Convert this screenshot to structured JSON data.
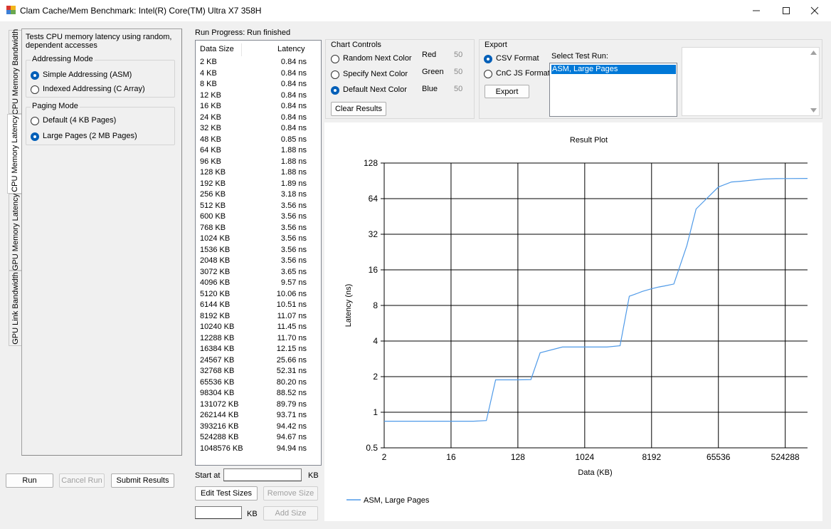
{
  "window": {
    "title": "Clam Cache/Mem Benchmark: Intel(R) Core(TM) Ultra X7 358H"
  },
  "side_tabs": [
    {
      "label": "CPU Memory Bandwidth",
      "selected": false
    },
    {
      "label": "CPU Memory Latency",
      "selected": true
    },
    {
      "label": "GPU Memory Latency",
      "selected": false
    },
    {
      "label": "GPU Link Bandwidth",
      "selected": false
    }
  ],
  "latency_page": {
    "description": "Tests CPU memory latency using random, dependent accesses",
    "addressing_mode": {
      "title": "Addressing Mode",
      "options": [
        {
          "label": "Simple Addressing (ASM)",
          "checked": true
        },
        {
          "label": "Indexed Addressing (C Array)",
          "checked": false
        }
      ]
    },
    "paging_mode": {
      "title": "Paging Mode",
      "options": [
        {
          "label": "Default (4 KB Pages)",
          "checked": false
        },
        {
          "label": "Large Pages (2 MB Pages)",
          "checked": true
        }
      ]
    }
  },
  "bottom_buttons": {
    "run": "Run",
    "cancel": "Cancel Run",
    "submit": "Submit Results"
  },
  "run_progress": {
    "label": "Run Progress:",
    "status": "Run finished"
  },
  "results_list": {
    "col_size": "Data Size",
    "col_latency": "Latency",
    "rows": [
      [
        "2 KB",
        "0.84 ns"
      ],
      [
        "4 KB",
        "0.84 ns"
      ],
      [
        "8 KB",
        "0.84 ns"
      ],
      [
        "12 KB",
        "0.84 ns"
      ],
      [
        "16 KB",
        "0.84 ns"
      ],
      [
        "24 KB",
        "0.84 ns"
      ],
      [
        "32 KB",
        "0.84 ns"
      ],
      [
        "48 KB",
        "0.85 ns"
      ],
      [
        "64 KB",
        "1.88 ns"
      ],
      [
        "96 KB",
        "1.88 ns"
      ],
      [
        "128 KB",
        "1.88 ns"
      ],
      [
        "192 KB",
        "1.89 ns"
      ],
      [
        "256 KB",
        "3.18 ns"
      ],
      [
        "512 KB",
        "3.56 ns"
      ],
      [
        "600 KB",
        "3.56 ns"
      ],
      [
        "768 KB",
        "3.56 ns"
      ],
      [
        "1024 KB",
        "3.56 ns"
      ],
      [
        "1536 KB",
        "3.56 ns"
      ],
      [
        "2048 KB",
        "3.56 ns"
      ],
      [
        "3072 KB",
        "3.65 ns"
      ],
      [
        "4096 KB",
        "9.57 ns"
      ],
      [
        "5120 KB",
        "10.06 ns"
      ],
      [
        "6144 KB",
        "10.51 ns"
      ],
      [
        "8192 KB",
        "11.07 ns"
      ],
      [
        "10240 KB",
        "11.45 ns"
      ],
      [
        "12288 KB",
        "11.70 ns"
      ],
      [
        "16384 KB",
        "12.15 ns"
      ],
      [
        "24567 KB",
        "25.66 ns"
      ],
      [
        "32768 KB",
        "52.31 ns"
      ],
      [
        "65536 KB",
        "80.20 ns"
      ],
      [
        "98304 KB",
        "88.52 ns"
      ],
      [
        "131072 KB",
        "89.79 ns"
      ],
      [
        "262144 KB",
        "93.71 ns"
      ],
      [
        "393216 KB",
        "94.42 ns"
      ],
      [
        "524288 KB",
        "94.67 ns"
      ],
      [
        "1048576 KB",
        "94.94 ns"
      ]
    ]
  },
  "size_controls": {
    "start_at_label": "Start at",
    "start_at_value": "",
    "unit": "KB",
    "edit_sizes": "Edit Test Sizes",
    "remove_size": "Remove Size",
    "add_size": "Add Size",
    "add_value": ""
  },
  "chart_controls": {
    "title": "Chart Controls",
    "options": [
      {
        "label": "Random Next Color",
        "checked": false
      },
      {
        "label": "Specify Next Color",
        "checked": false
      },
      {
        "label": "Default Next Color",
        "checked": true
      }
    ],
    "red_label": "Red",
    "red_value": "50",
    "green_label": "Green",
    "green_value": "50",
    "blue_label": "Blue",
    "blue_value": "50",
    "clear": "Clear Results"
  },
  "export": {
    "title": "Export",
    "options": [
      {
        "label": "CSV Format",
        "checked": true
      },
      {
        "label": "CnC JS Format",
        "checked": false
      }
    ],
    "button": "Export",
    "select_label": "Select Test Run:",
    "runs": [
      "ASM, Large Pages"
    ],
    "selected_run": "ASM, Large Pages"
  },
  "colors": {
    "series": "#4f9ae8",
    "selection": "#0078d7"
  },
  "chart_data": {
    "type": "line",
    "title": "Result Plot",
    "xlabel": "Data (KB)",
    "ylabel": "Latency (ns)",
    "x_scale": "log2",
    "y_scale": "log2",
    "xlim": [
      2,
      1048576
    ],
    "ylim": [
      0.5,
      128
    ],
    "x_ticks": [
      "2",
      "16",
      "128",
      "1024",
      "8192",
      "65536",
      "524288"
    ],
    "y_ticks": [
      "0.5",
      "1",
      "2",
      "4",
      "8",
      "16",
      "32",
      "64",
      "128"
    ],
    "grid": true,
    "legend_position": "bottom-left",
    "series": [
      {
        "name": "ASM, Large Pages",
        "x": [
          2,
          4,
          8,
          12,
          16,
          24,
          32,
          48,
          64,
          96,
          128,
          192,
          256,
          512,
          600,
          768,
          1024,
          1536,
          2048,
          3072,
          4096,
          5120,
          6144,
          8192,
          10240,
          12288,
          16384,
          24567,
          32768,
          65536,
          98304,
          131072,
          262144,
          393216,
          524288,
          1048576
        ],
        "y": [
          0.84,
          0.84,
          0.84,
          0.84,
          0.84,
          0.84,
          0.84,
          0.85,
          1.88,
          1.88,
          1.88,
          1.89,
          3.18,
          3.56,
          3.56,
          3.56,
          3.56,
          3.56,
          3.56,
          3.65,
          9.57,
          10.06,
          10.51,
          11.07,
          11.45,
          11.7,
          12.15,
          25.66,
          52.31,
          80.2,
          88.52,
          89.79,
          93.71,
          94.42,
          94.67,
          94.94
        ]
      }
    ]
  }
}
